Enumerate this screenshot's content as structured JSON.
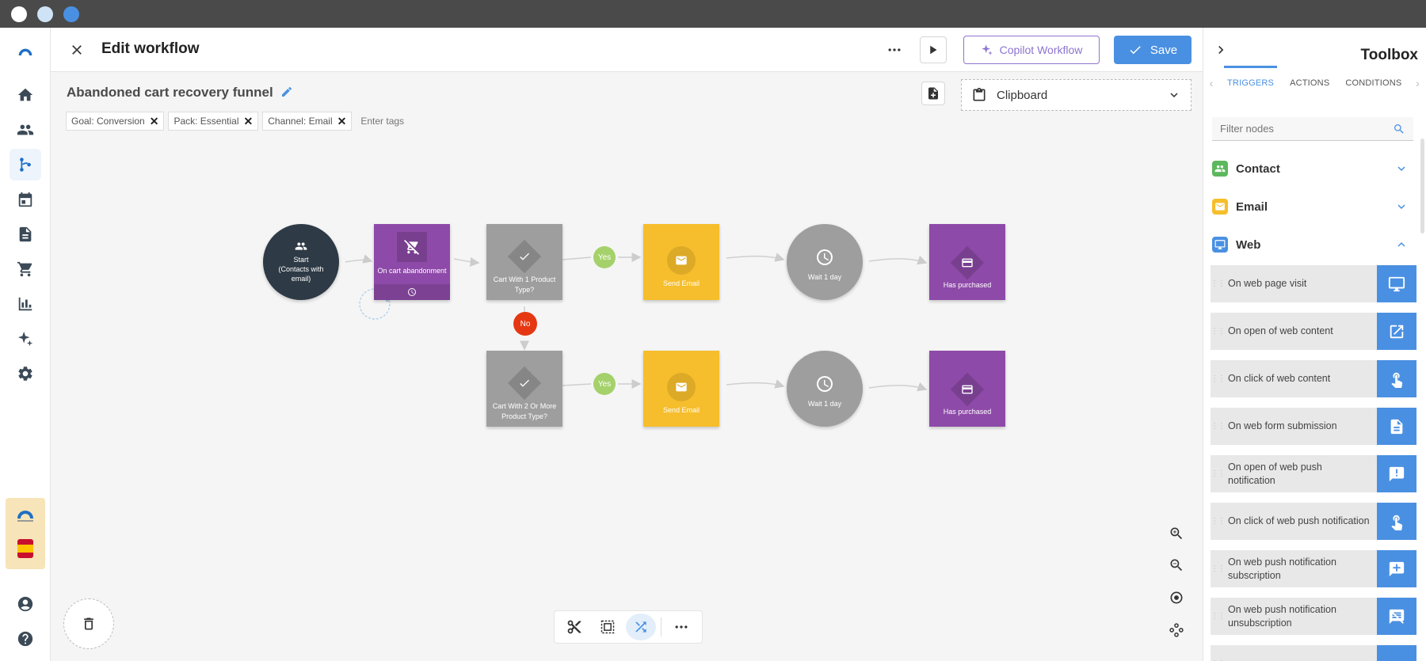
{
  "window": {
    "controls": [
      "close",
      "minimize",
      "maximize"
    ]
  },
  "left_nav": {
    "items": [
      {
        "icon": "logo-icon"
      },
      {
        "icon": "home-icon"
      },
      {
        "icon": "contacts-icon"
      },
      {
        "icon": "workflow-icon",
        "active": true
      },
      {
        "icon": "calendar-icon"
      },
      {
        "icon": "document-icon"
      },
      {
        "icon": "cart-icon"
      },
      {
        "icon": "chart-icon"
      },
      {
        "icon": "sparkle-icon"
      },
      {
        "icon": "gear-icon"
      },
      {
        "icon": "account-icon"
      },
      {
        "icon": "help-icon"
      }
    ]
  },
  "header": {
    "title": "Edit workflow",
    "copilot_label": "Copilot Workflow",
    "save_label": "Save"
  },
  "workflow": {
    "name": "Abandoned cart recovery funnel",
    "tags": [
      {
        "label": "Goal: Conversion"
      },
      {
        "label": "Pack: Essential"
      },
      {
        "label": "Channel: Email"
      }
    ],
    "tags_placeholder": "Enter tags",
    "clipboard_label": "Clipboard"
  },
  "nodes": {
    "start": {
      "label": "Start\n(Contacts with email)",
      "color": "#2e3a45"
    },
    "trigger": {
      "label": "On cart abandonment",
      "color": "#8e4aa8"
    },
    "cond1": {
      "label": "Cart With 1 Product Type?",
      "color": "#9e9e9e"
    },
    "cond2": {
      "label": "Cart With 2 Or More Product Type?",
      "color": "#9e9e9e"
    },
    "email1": {
      "label": "Send Email",
      "color": "#f6be2c"
    },
    "email2": {
      "label": "Send Email",
      "color": "#f6be2c"
    },
    "wait1": {
      "label": "Wait 1 day",
      "color": "#9e9e9e"
    },
    "wait2": {
      "label": "Wait 1 day",
      "color": "#9e9e9e"
    },
    "purchase1": {
      "label": "Has purchased",
      "color": "#8e4aa8"
    },
    "purchase2": {
      "label": "Has purchased",
      "color": "#8e4aa8"
    },
    "yes1": "Yes",
    "yes2": "Yes",
    "no": "No"
  },
  "toolbox": {
    "title": "Toolbox",
    "tabs": [
      "TRIGGERS",
      "ACTIONS",
      "CONDITIONS"
    ],
    "active_tab": "TRIGGERS",
    "filter_placeholder": "Filter nodes",
    "sections": [
      {
        "label": "Contact",
        "color": "#5cb85c",
        "expanded": false
      },
      {
        "label": "Email",
        "color": "#f6be2c",
        "expanded": false
      },
      {
        "label": "Web",
        "color": "#4a90e2",
        "expanded": true
      }
    ],
    "items": [
      {
        "label": "On web page visit",
        "icon": "monitor-icon"
      },
      {
        "label": "On open of web content",
        "icon": "open-external-icon"
      },
      {
        "label": "On click of web content",
        "icon": "tap-icon"
      },
      {
        "label": "On web form submission",
        "icon": "form-icon"
      },
      {
        "label": "On open of web push notification",
        "icon": "alert-message-icon"
      },
      {
        "label": "On click of web push notification",
        "icon": "tap-icon"
      },
      {
        "label": "On web push notification subscription",
        "icon": "message-add-icon"
      },
      {
        "label": "On web push notification unsubscription",
        "icon": "message-off-icon"
      }
    ]
  },
  "colors": {
    "accent": "#4a90e2",
    "copilot": "#8d74cf",
    "yes": "#a5d16b",
    "no": "#e53812"
  }
}
